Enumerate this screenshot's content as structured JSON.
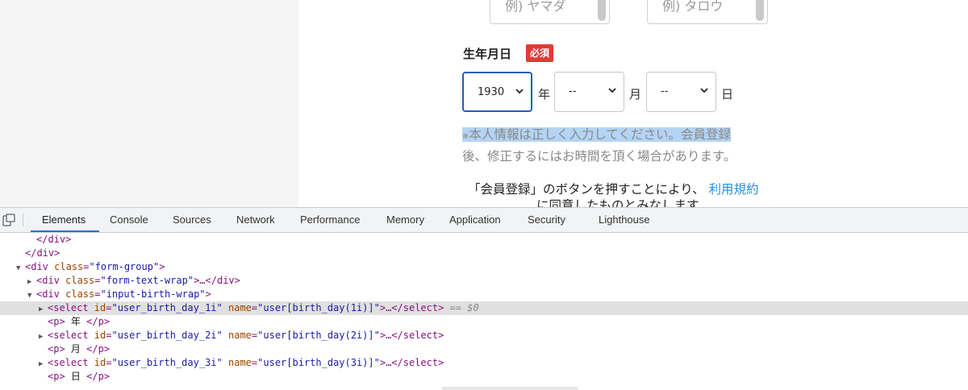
{
  "form": {
    "last_name_placeholder": "例) ヤマダ",
    "first_name_placeholder": "例) タロウ",
    "birth_label": "生年月日",
    "required_badge": "必須",
    "year_value": "1930",
    "year_unit": "年",
    "month_value": "--",
    "month_unit": "月",
    "day_value": "--",
    "day_unit": "日",
    "note_mark": "※",
    "note_highlight": "本人情報は正しく入力してください。会員登録",
    "note_rest": "後、修正するにはお時間を頂く場合があります。",
    "agree_text": "「会員登録」のボタンを押すことにより、",
    "agree_link": "利用規約",
    "agree_text2": "に同意したものとみなします"
  },
  "devtools": {
    "tabs": [
      "Elements",
      "Console",
      "Sources",
      "Network",
      "Performance",
      "Memory",
      "Application",
      "Security",
      "Lighthouse"
    ],
    "active_tab": "Elements",
    "dom": {
      "r0": "</div>",
      "r1": "</div>",
      "r2_tag": "<div ",
      "r2_attr": "class",
      "r2_val": "\"form-group\"",
      "r2_end": ">",
      "r3_tag": "<div ",
      "r3_attr": "class",
      "r3_val": "\"form-text-wrap\"",
      "r3_end": ">…</div>",
      "r4_tag": "<div ",
      "r4_attr": "class",
      "r4_val": "\"input-birth-wrap\"",
      "r4_end": ">",
      "r5_tag": "<select ",
      "r5_a1": "id",
      "r5_v1": "\"user_birth_day_1i\"",
      "r5_a2": "name",
      "r5_v2": "\"user[birth_day(1i)]\"",
      "r5_end": ">…</select>",
      "r5_marker": " == $0",
      "r6_open": "<p>",
      "r6_text": " 年 ",
      "r6_close": "</p>",
      "r7_tag": "<select ",
      "r7_a1": "id",
      "r7_v1": "\"user_birth_day_2i\"",
      "r7_a2": "name",
      "r7_v2": "\"user[birth_day(2i)]\"",
      "r7_end": ">…</select>",
      "r8_open": "<p>",
      "r8_text": " 月 ",
      "r8_close": "</p>",
      "r9_tag": "<select ",
      "r9_a1": "id",
      "r9_v1": "\"user_birth_day_3i\"",
      "r9_a2": "name",
      "r9_v2": "\"user[birth_day(3i)]\"",
      "r9_end": ">…</select>",
      "r10_open": "<p>",
      "r10_text": " 日 ",
      "r10_close": "</p>"
    }
  }
}
